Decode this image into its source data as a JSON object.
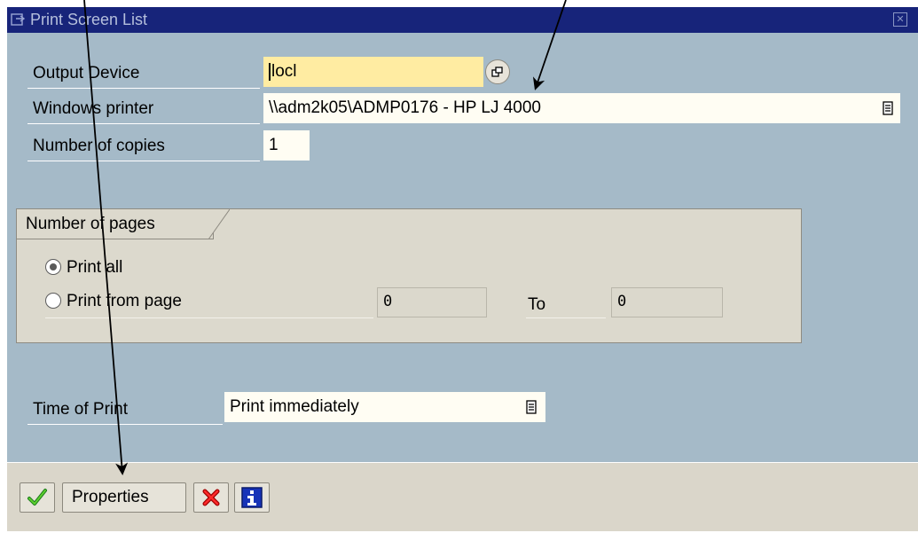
{
  "window": {
    "title": "Print Screen List"
  },
  "form": {
    "output_device_label": "Output Device",
    "output_device_value": "locl",
    "windows_printer_label": "Windows printer",
    "windows_printer_value": "\\\\adm2k05\\ADMP0176 - HP LJ 4000",
    "copies_label": "Number of copies",
    "copies_value": "1"
  },
  "pages_group": {
    "title": "Number of pages",
    "print_all_label": "Print all",
    "print_from_label": "Print from page",
    "from_value": "0",
    "to_label": "To",
    "to_value": "0",
    "selected": "print_all"
  },
  "time": {
    "label": "Time of Print",
    "value": "Print immediately"
  },
  "toolbar": {
    "properties_label": "Properties"
  },
  "colors": {
    "title_bar": "#17247a",
    "panel": "#a5bac8",
    "required_field": "#ffeca2",
    "footer": "#dad6ca"
  },
  "icons": [
    "window-icon",
    "close-window-icon",
    "possible-entries-icon",
    "dropdown-icon",
    "check-icon",
    "cancel-icon",
    "info-icon"
  ]
}
